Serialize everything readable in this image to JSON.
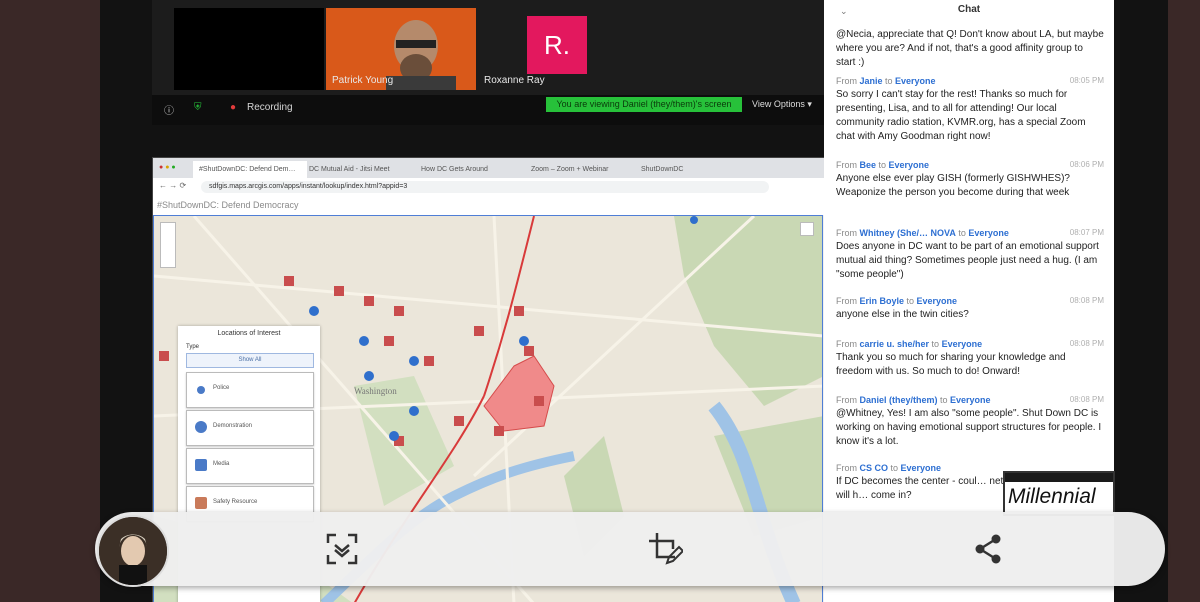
{
  "video_tiles": [
    {
      "name": "Patrick Young",
      "bg": "#e0661f"
    },
    {
      "name": "Roxanne Ray",
      "initial": "R.",
      "bg": "#e3185e"
    }
  ],
  "controls": {
    "recording_label": "Recording",
    "viewing_banner": "You are viewing Daniel (they/them)'s screen",
    "view_options": "View Options"
  },
  "browser": {
    "tabs": [
      "#ShutDownDC: Defend Dem…",
      "DC Mutual Aid - Jitsi Meet",
      "How DC Gets Around",
      "Zoom – Zoom + Webinar",
      "ShutDownDC"
    ],
    "url": "sdfgis.maps.arcgis.com/apps/instant/lookup/index.html?appid=3",
    "app_title": "#ShutDownDC: Defend Democracy"
  },
  "map": {
    "city_label": "Washington",
    "legend": {
      "title": "Locations of Interest",
      "type_label": "Type",
      "select_value": "Show All",
      "items": [
        "Police",
        "Demonstration",
        "Media",
        "Safety Resource"
      ]
    }
  },
  "chat": {
    "title": "Chat",
    "intro_text": "@Necia, appreciate that Q! Don't know about LA, but maybe where you are? And if not, that's a good affinity group to start :)",
    "messages": [
      {
        "from": "Janie",
        "to": "Everyone",
        "time": "08:05 PM",
        "text": "So sorry I can't stay for the rest! Thanks so much for presenting, Lisa, and to all for attending! Our local community radio station, KVMR.org, has a special Zoom chat with Amy Goodman right now!"
      },
      {
        "from": "Bee",
        "to": "Everyone",
        "time": "08:06 PM",
        "text": "Anyone else ever play GISH (formerly GISHWHES)? Weaponize the person you become during that week"
      },
      {
        "from": "Whitney (She/… NOVA",
        "to": "Everyone",
        "time": "08:07 PM",
        "text": "Does anyone in DC want to be part of an emotional support mutual aid thing? Sometimes people just need a hug. (I am \"some people\")"
      },
      {
        "from": "Erin Boyle",
        "to": "Everyone",
        "time": "08:08 PM",
        "text": "anyone else in the twin cities?"
      },
      {
        "from": "carrie u. she/her",
        "to": "Everyone",
        "time": "08:08 PM",
        "text": "Thank you so much for sharing your knowledge and freedom with us. So much to do! Onward!"
      },
      {
        "from": "Daniel (they/them)",
        "to": "Everyone",
        "time": "08:08 PM",
        "text": "@Whitney, Yes! I am also \"some people\". Shut Down DC is working on having emotional support structures for people. I know it's a lot."
      },
      {
        "from": "CS CO",
        "to": "Everyone",
        "time": "",
        "text": "If DC becomes the center - coul… network of local folks who will h… come in?"
      }
    ]
  },
  "watermark": "Millennial",
  "toolbar": {
    "buttons": [
      "scan-icon",
      "crop-edit-icon",
      "share-icon"
    ]
  }
}
